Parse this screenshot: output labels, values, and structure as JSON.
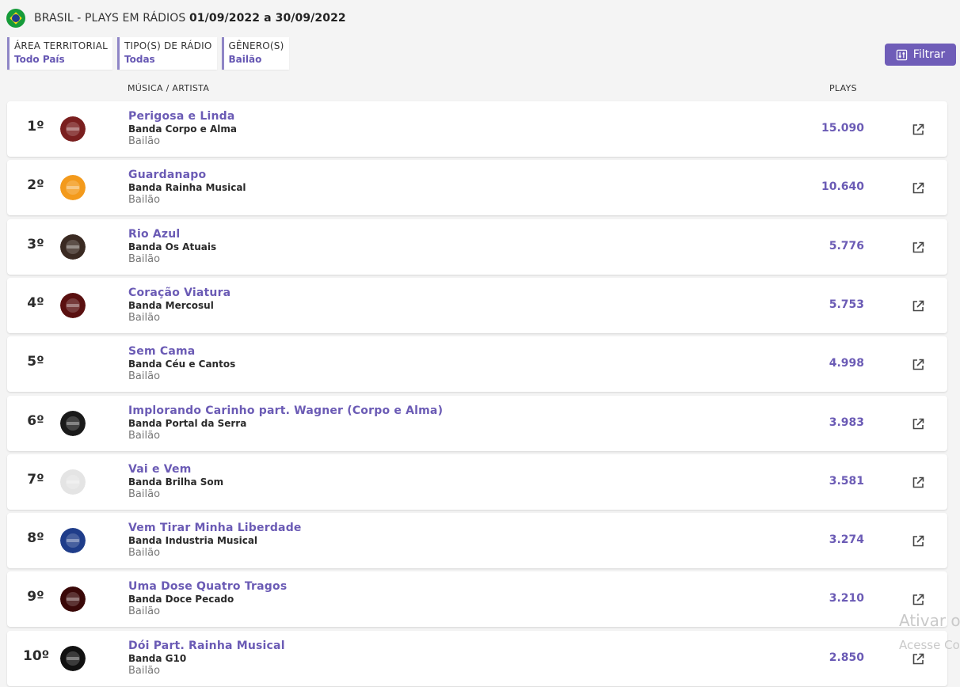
{
  "header": {
    "title_prefix": "BRASIL - PLAYS EM RÁDIOS",
    "period": "01/09/2022 a 30/09/2022"
  },
  "filters": [
    {
      "label": "ÁREA TERRITORIAL",
      "value": "Todo País"
    },
    {
      "label": "TIPO(S) DE RÁDIO",
      "value": "Todas"
    },
    {
      "label": "GÊNERO(S)",
      "value": "Bailão"
    }
  ],
  "filter_button": {
    "label": "Filtrar"
  },
  "columns": {
    "music_artist": "MÚSICA / ARTISTA",
    "plays": "PLAYS"
  },
  "rows": [
    {
      "rank": "1º",
      "song": "Perigosa e Linda",
      "artist": "Banda Corpo e Alma",
      "genre": "Bailão",
      "plays": "15.090",
      "avatar_color": "#7a1f1f"
    },
    {
      "rank": "2º",
      "song": "Guardanapo",
      "artist": "Banda Rainha Musical",
      "genre": "Bailão",
      "plays": "10.640",
      "avatar_color": "#f39a1c"
    },
    {
      "rank": "3º",
      "song": "Rio Azul",
      "artist": "Banda Os Atuais",
      "genre": "Bailão",
      "plays": "5.776",
      "avatar_color": "#3a2a22"
    },
    {
      "rank": "4º",
      "song": "Coração Viatura",
      "artist": "Banda Mercosul",
      "genre": "Bailão",
      "plays": "5.753",
      "avatar_color": "#5a1010"
    },
    {
      "rank": "5º",
      "song": "Sem Cama",
      "artist": "Banda Céu e Cantos",
      "genre": "Bailão",
      "plays": "4.998",
      "avatar_color": "#ffffff"
    },
    {
      "rank": "6º",
      "song": "Implorando Carinho part. Wagner (Corpo e Alma)",
      "artist": "Banda Portal da Serra",
      "genre": "Bailão",
      "plays": "3.983",
      "avatar_color": "#1a1a1a"
    },
    {
      "rank": "7º",
      "song": "Vai e Vem",
      "artist": "Banda Brilha Som",
      "genre": "Bailão",
      "plays": "3.581",
      "avatar_color": "#e4e4e4"
    },
    {
      "rank": "8º",
      "song": "Vem Tirar Minha Liberdade",
      "artist": "Banda Industria Musical",
      "genre": "Bailão",
      "plays": "3.274",
      "avatar_color": "#1f3d8a"
    },
    {
      "rank": "9º",
      "song": "Uma Dose Quatro Tragos",
      "artist": "Banda Doce Pecado",
      "genre": "Bailão",
      "plays": "3.210",
      "avatar_color": "#3a0808"
    },
    {
      "rank": "10º",
      "song": "Dói Part. Rainha Musical",
      "artist": "Banda G10",
      "genre": "Bailão",
      "plays": "2.850",
      "avatar_color": "#111111"
    }
  ],
  "watermark": {
    "line1": "Ativar o",
    "line2": "Acesse Co"
  },
  "colors": {
    "accent": "#6b5bb5",
    "button": "#6f5db8"
  }
}
